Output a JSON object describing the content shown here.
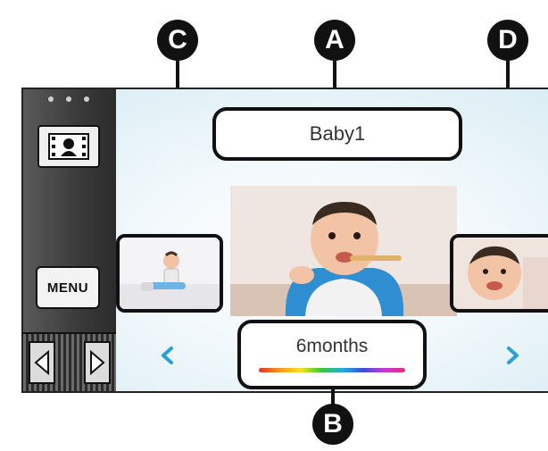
{
  "callouts": {
    "a": "A",
    "b": "B",
    "c": "C",
    "d": "D"
  },
  "sidebar": {
    "mode_icon": "film-frame-icon",
    "menu_label": "MENU",
    "prev_icon": "triangle-left-icon",
    "next_icon": "triangle-right-icon"
  },
  "main": {
    "name_label": "Baby1",
    "age_label": "6months",
    "prev_chevron": "chevron-left-icon",
    "next_chevron": "chevron-right-icon"
  },
  "colors": {
    "accent_chevron": "#2a9fd8",
    "outline": "#111111"
  }
}
